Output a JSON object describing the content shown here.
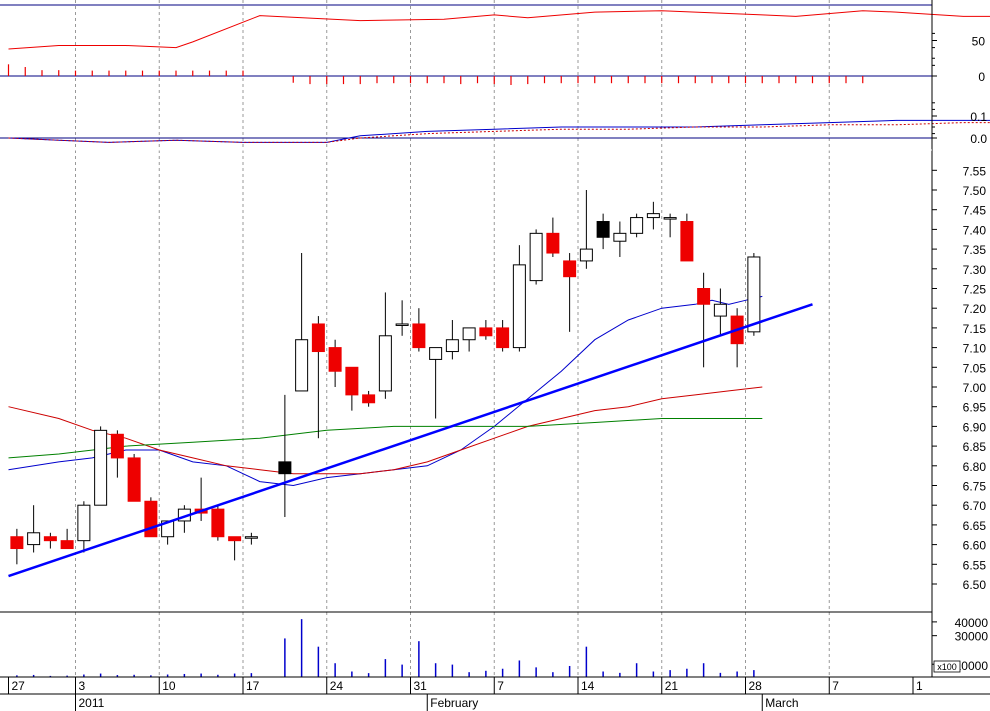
{
  "chart_data": [
    {
      "panel": "oscillator",
      "type": "line",
      "y_ticks": [
        "50",
        "0"
      ],
      "reference_levels": [
        100,
        0
      ],
      "line_x": [
        -1,
        2,
        6,
        9,
        10,
        14,
        20,
        25,
        28,
        30,
        34,
        38,
        40,
        44,
        46,
        50,
        52,
        56,
        60,
        64,
        67,
        71,
        74,
        76,
        78,
        82,
        86,
        88
      ],
      "line_y": [
        38,
        43,
        43,
        40,
        48,
        85,
        78,
        80,
        86,
        82,
        90,
        92,
        90,
        86,
        84,
        92,
        90,
        84,
        84,
        84,
        66,
        68,
        64,
        58,
        52,
        45,
        62,
        78
      ],
      "histogram_x": [
        -1,
        0,
        1,
        2,
        3,
        4,
        5,
        6,
        7,
        8,
        9,
        10,
        11,
        12,
        13,
        16,
        17,
        18,
        19,
        20,
        21,
        22,
        23,
        24,
        25,
        26,
        27,
        28,
        29,
        30,
        31,
        32,
        33,
        34,
        35,
        36,
        37,
        38,
        39,
        40,
        41,
        42,
        43,
        44,
        45,
        46,
        47,
        48,
        49,
        50
      ],
      "histogram_y": [
        26,
        20,
        13,
        13,
        12,
        12,
        12,
        12,
        12,
        12,
        12,
        12,
        12,
        12,
        12,
        -15,
        -18,
        -18,
        -18,
        -18,
        -16,
        -16,
        -16,
        -16,
        -16,
        -18,
        -16,
        -18,
        -20,
        -18,
        -16,
        -16,
        -16,
        -16,
        -16,
        -16,
        -16,
        -16,
        -16,
        -16,
        -16,
        -16,
        -16,
        -16,
        -16,
        -16,
        -16,
        -16,
        -16,
        -16
      ]
    },
    {
      "panel": "macd",
      "type": "line",
      "y_ticks": [
        "0.1",
        "0.0"
      ],
      "series": [
        {
          "role": "macd",
          "color": "#0000cc",
          "x": [
            -1,
            2,
            5,
            9,
            13,
            16,
            18,
            20,
            24,
            28,
            32,
            36,
            40,
            44,
            48,
            52,
            56,
            60,
            64,
            67,
            70,
            72,
            74,
            76,
            78,
            80,
            82,
            84,
            86,
            88
          ],
          "y": [
            0.0,
            -0.01,
            -0.02,
            -0.01,
            -0.02,
            -0.02,
            -0.02,
            0.01,
            0.03,
            0.04,
            0.05,
            0.05,
            0.05,
            0.06,
            0.07,
            0.08,
            0.08,
            0.08,
            0.08,
            0.07,
            0.06,
            0.05,
            0.05,
            0.05,
            0.05,
            0.05,
            0.05,
            0.05,
            0.05,
            0.04
          ]
        },
        {
          "role": "signal",
          "color": "#cc0000",
          "dashed": true,
          "x": [
            -1,
            2,
            5,
            9,
            13,
            16,
            18,
            20,
            24,
            28,
            32,
            36,
            40,
            44,
            48,
            52,
            56,
            60,
            64,
            67,
            70,
            72,
            74,
            76,
            78,
            80,
            82,
            84,
            86,
            88
          ],
          "y": [
            0.0,
            -0.01,
            -0.02,
            -0.01,
            -0.02,
            -0.02,
            -0.02,
            0.0,
            0.02,
            0.03,
            0.04,
            0.04,
            0.05,
            0.05,
            0.06,
            0.06,
            0.07,
            0.07,
            0.07,
            0.07,
            0.07,
            0.06,
            0.06,
            0.05,
            0.05,
            0.05,
            0.05,
            0.05,
            0.05,
            0.05
          ]
        }
      ]
    },
    {
      "panel": "price",
      "type": "candlestick",
      "y_ticks": [
        "7.55",
        "7.50",
        "7.45",
        "7.40",
        "7.35",
        "7.30",
        "7.25",
        "7.20",
        "7.15",
        "7.10",
        "7.05",
        "7.00",
        "6.95",
        "6.90",
        "6.85",
        "6.80",
        "6.75",
        "6.70",
        "6.65",
        "6.60",
        "6.55",
        "6.50"
      ],
      "ylim": [
        6.46,
        7.58
      ],
      "candles": [
        {
          "x": -0.5,
          "o": 6.62,
          "h": 6.64,
          "l": 6.55,
          "c": 6.59
        },
        {
          "x": 0.5,
          "o": 6.6,
          "h": 6.7,
          "l": 6.58,
          "c": 6.63
        },
        {
          "x": 1.5,
          "o": 6.62,
          "h": 6.63,
          "l": 6.59,
          "c": 6.61
        },
        {
          "x": 2.5,
          "o": 6.61,
          "h": 6.64,
          "l": 6.59,
          "c": 6.59
        },
        {
          "x": 3.5,
          "o": 6.61,
          "h": 6.71,
          "l": 6.58,
          "c": 6.7
        },
        {
          "x": 4.5,
          "o": 6.7,
          "h": 6.9,
          "l": 6.72,
          "c": 6.89
        },
        {
          "x": 5.5,
          "o": 6.88,
          "h": 6.89,
          "l": 6.77,
          "c": 6.82
        },
        {
          "x": 6.5,
          "o": 6.82,
          "h": 6.83,
          "l": 6.71,
          "c": 6.71
        },
        {
          "x": 7.5,
          "o": 6.71,
          "h": 6.72,
          "l": 6.62,
          "c": 6.62
        },
        {
          "x": 8.5,
          "o": 6.62,
          "h": 6.66,
          "l": 6.6,
          "c": 6.66
        },
        {
          "x": 9.5,
          "o": 6.66,
          "h": 6.7,
          "l": 6.63,
          "c": 6.69
        },
        {
          "x": 10.5,
          "o": 6.69,
          "h": 6.77,
          "l": 6.66,
          "c": 6.68
        },
        {
          "x": 11.5,
          "o": 6.69,
          "h": 6.7,
          "l": 6.61,
          "c": 6.62
        },
        {
          "x": 12.5,
          "o": 6.62,
          "h": 6.62,
          "l": 6.56,
          "c": 6.61
        },
        {
          "x": 13.5,
          "o": 6.62,
          "h": 6.63,
          "l": 6.6,
          "c": 6.62
        },
        {
          "x": 15.5,
          "o": 6.78,
          "h": 6.98,
          "l": 6.67,
          "c": 6.81,
          "filled": true
        },
        {
          "x": 16.5,
          "o": 6.99,
          "h": 7.34,
          "l": 6.99,
          "c": 7.12
        },
        {
          "x": 17.5,
          "o": 7.16,
          "h": 7.18,
          "l": 6.87,
          "c": 7.09
        },
        {
          "x": 18.5,
          "o": 7.1,
          "h": 7.12,
          "l": 7.0,
          "c": 7.04
        },
        {
          "x": 19.5,
          "o": 7.05,
          "h": 7.05,
          "l": 6.94,
          "c": 6.98
        },
        {
          "x": 20.5,
          "o": 6.98,
          "h": 6.99,
          "l": 6.95,
          "c": 6.96
        },
        {
          "x": 21.5,
          "o": 6.99,
          "h": 7.24,
          "l": 6.97,
          "c": 7.13
        },
        {
          "x": 22.5,
          "o": 7.16,
          "h": 7.22,
          "l": 7.13,
          "c": 7.16
        },
        {
          "x": 23.5,
          "o": 7.16,
          "h": 7.2,
          "l": 7.09,
          "c": 7.1
        },
        {
          "x": 24.5,
          "o": 7.07,
          "h": 7.1,
          "l": 6.92,
          "c": 7.1
        },
        {
          "x": 25.5,
          "o": 7.09,
          "h": 7.17,
          "l": 7.07,
          "c": 7.12
        },
        {
          "x": 26.5,
          "o": 7.12,
          "h": 7.15,
          "l": 7.09,
          "c": 7.15
        },
        {
          "x": 27.5,
          "o": 7.15,
          "h": 7.17,
          "l": 7.12,
          "c": 7.13
        },
        {
          "x": 28.5,
          "o": 7.15,
          "h": 7.17,
          "l": 7.09,
          "c": 7.1
        },
        {
          "x": 29.5,
          "o": 7.1,
          "h": 7.36,
          "l": 7.09,
          "c": 7.31
        },
        {
          "x": 30.5,
          "o": 7.27,
          "h": 7.4,
          "l": 7.26,
          "c": 7.39
        },
        {
          "x": 31.5,
          "o": 7.39,
          "h": 7.43,
          "l": 7.33,
          "c": 7.34
        },
        {
          "x": 32.5,
          "o": 7.32,
          "h": 7.34,
          "l": 7.14,
          "c": 7.28
        },
        {
          "x": 33.5,
          "o": 7.32,
          "h": 7.5,
          "l": 7.3,
          "c": 7.35
        },
        {
          "x": 34.5,
          "o": 7.38,
          "h": 7.44,
          "l": 7.35,
          "c": 7.42,
          "filled": true
        },
        {
          "x": 35.5,
          "o": 7.37,
          "h": 7.42,
          "l": 7.33,
          "c": 7.39
        },
        {
          "x": 36.5,
          "o": 7.39,
          "h": 7.44,
          "l": 7.38,
          "c": 7.43
        },
        {
          "x": 37.5,
          "o": 7.43,
          "h": 7.47,
          "l": 7.4,
          "c": 7.44
        },
        {
          "x": 38.5,
          "o": 7.43,
          "h": 7.44,
          "l": 7.38,
          "c": 7.43
        },
        {
          "x": 39.5,
          "o": 7.42,
          "h": 7.44,
          "l": 7.32,
          "c": 7.32
        },
        {
          "x": 40.5,
          "o": 7.25,
          "h": 7.29,
          "l": 7.05,
          "c": 7.21
        },
        {
          "x": 41.5,
          "o": 7.18,
          "h": 7.25,
          "l": 7.13,
          "c": 7.21
        },
        {
          "x": 42.5,
          "o": 7.18,
          "h": 7.2,
          "l": 7.05,
          "c": 7.11
        },
        {
          "x": 43.5,
          "o": 7.14,
          "h": 7.34,
          "l": 7.13,
          "c": 7.33
        }
      ],
      "moving_averages": [
        {
          "color": "#0000cc",
          "x": [
            -1,
            2,
            4,
            6,
            8,
            10,
            12,
            14,
            16,
            18,
            20,
            22,
            24,
            26,
            28,
            30,
            32,
            34,
            36,
            38,
            40,
            41,
            42,
            43,
            44
          ],
          "y": [
            6.79,
            6.81,
            6.82,
            6.84,
            6.84,
            6.81,
            6.8,
            6.76,
            6.75,
            6.77,
            6.78,
            6.79,
            6.8,
            6.84,
            6.9,
            6.97,
            7.04,
            7.12,
            7.17,
            7.2,
            7.21,
            7.22,
            7.21,
            7.22,
            7.23
          ]
        },
        {
          "color": "#cc0000",
          "x": [
            -1,
            2,
            4,
            6,
            8,
            10,
            12,
            14,
            16,
            18,
            20,
            22,
            24,
            26,
            28,
            30,
            32,
            34,
            36,
            38,
            40,
            42,
            44
          ],
          "y": [
            6.95,
            6.92,
            6.89,
            6.87,
            6.84,
            6.82,
            6.8,
            6.79,
            6.78,
            6.78,
            6.78,
            6.79,
            6.81,
            6.84,
            6.87,
            6.9,
            6.92,
            6.94,
            6.95,
            6.97,
            6.98,
            6.99,
            7.0
          ]
        },
        {
          "color": "#008000",
          "x": [
            -1,
            2,
            6,
            10,
            14,
            16,
            18,
            22,
            26,
            30,
            34,
            38,
            42,
            44
          ],
          "y": [
            6.82,
            6.83,
            6.85,
            6.86,
            6.87,
            6.88,
            6.89,
            6.9,
            6.9,
            6.9,
            6.91,
            6.92,
            6.92,
            6.92
          ]
        }
      ],
      "trendline": {
        "color": "#0000ff",
        "from": {
          "x": -1,
          "y": 6.52
        },
        "to": {
          "x": 47,
          "y": 7.21
        }
      }
    },
    {
      "panel": "volume",
      "type": "bar",
      "y_ticks": [
        "40000",
        "30000",
        "10000"
      ],
      "scale_label": "x100",
      "ylim": [
        0,
        45000
      ],
      "values": [
        {
          "x": -0.5,
          "v": 1200
        },
        {
          "x": 0.5,
          "v": 1500
        },
        {
          "x": 1.5,
          "v": 800
        },
        {
          "x": 2.5,
          "v": 1000
        },
        {
          "x": 3.5,
          "v": 1800
        },
        {
          "x": 4.5,
          "v": 2500
        },
        {
          "x": 5.5,
          "v": 1400
        },
        {
          "x": 6.5,
          "v": 1600
        },
        {
          "x": 7.5,
          "v": 1200
        },
        {
          "x": 8.5,
          "v": 1800
        },
        {
          "x": 9.5,
          "v": 2200
        },
        {
          "x": 10.5,
          "v": 2500
        },
        {
          "x": 11.5,
          "v": 1600
        },
        {
          "x": 12.5,
          "v": 2500
        },
        {
          "x": 13.5,
          "v": 2800
        },
        {
          "x": 15.5,
          "v": 28000
        },
        {
          "x": 16.5,
          "v": 42000
        },
        {
          "x": 17.5,
          "v": 22000
        },
        {
          "x": 18.5,
          "v": 10000
        },
        {
          "x": 19.5,
          "v": 4000
        },
        {
          "x": 20.5,
          "v": 2800
        },
        {
          "x": 21.5,
          "v": 13000
        },
        {
          "x": 22.5,
          "v": 9000
        },
        {
          "x": 23.5,
          "v": 26000
        },
        {
          "x": 24.5,
          "v": 10000
        },
        {
          "x": 25.5,
          "v": 9000
        },
        {
          "x": 26.5,
          "v": 3500
        },
        {
          "x": 27.5,
          "v": 4500
        },
        {
          "x": 28.5,
          "v": 6000
        },
        {
          "x": 29.5,
          "v": 12000
        },
        {
          "x": 30.5,
          "v": 7000
        },
        {
          "x": 31.5,
          "v": 3500
        },
        {
          "x": 32.5,
          "v": 8000
        },
        {
          "x": 33.5,
          "v": 22000
        },
        {
          "x": 34.5,
          "v": 4000
        },
        {
          "x": 35.5,
          "v": 3000
        },
        {
          "x": 36.5,
          "v": 10000
        },
        {
          "x": 37.5,
          "v": 4000
        },
        {
          "x": 38.5,
          "v": 5000
        },
        {
          "x": 39.5,
          "v": 6000
        },
        {
          "x": 40.5,
          "v": 10000
        },
        {
          "x": 41.5,
          "v": 3000
        },
        {
          "x": 42.5,
          "v": 4000
        },
        {
          "x": 43.5,
          "v": 5000
        }
      ]
    }
  ],
  "x_axis": {
    "day_labels": [
      {
        "x": -1,
        "label": "27"
      },
      {
        "x": 3,
        "label": "3"
      },
      {
        "x": 8,
        "label": "10"
      },
      {
        "x": 13,
        "label": "17"
      },
      {
        "x": 18,
        "label": "24"
      },
      {
        "x": 23,
        "label": "31"
      },
      {
        "x": 28,
        "label": "7"
      },
      {
        "x": 33,
        "label": "14"
      },
      {
        "x": 38,
        "label": "21"
      },
      {
        "x": 43,
        "label": "28"
      },
      {
        "x": 48,
        "label": "7"
      },
      {
        "x": 53,
        "label": "1"
      }
    ],
    "period_labels": [
      {
        "x": 3,
        "label": "2011"
      },
      {
        "x": 24,
        "label": "February"
      },
      {
        "x": 44,
        "label": "March"
      }
    ],
    "gridlines": [
      3,
      8,
      13,
      18,
      23,
      28,
      33,
      38,
      43,
      48
    ]
  },
  "colors": {
    "down": "#ee0000",
    "axis": "#000080",
    "grid": "#999999"
  }
}
